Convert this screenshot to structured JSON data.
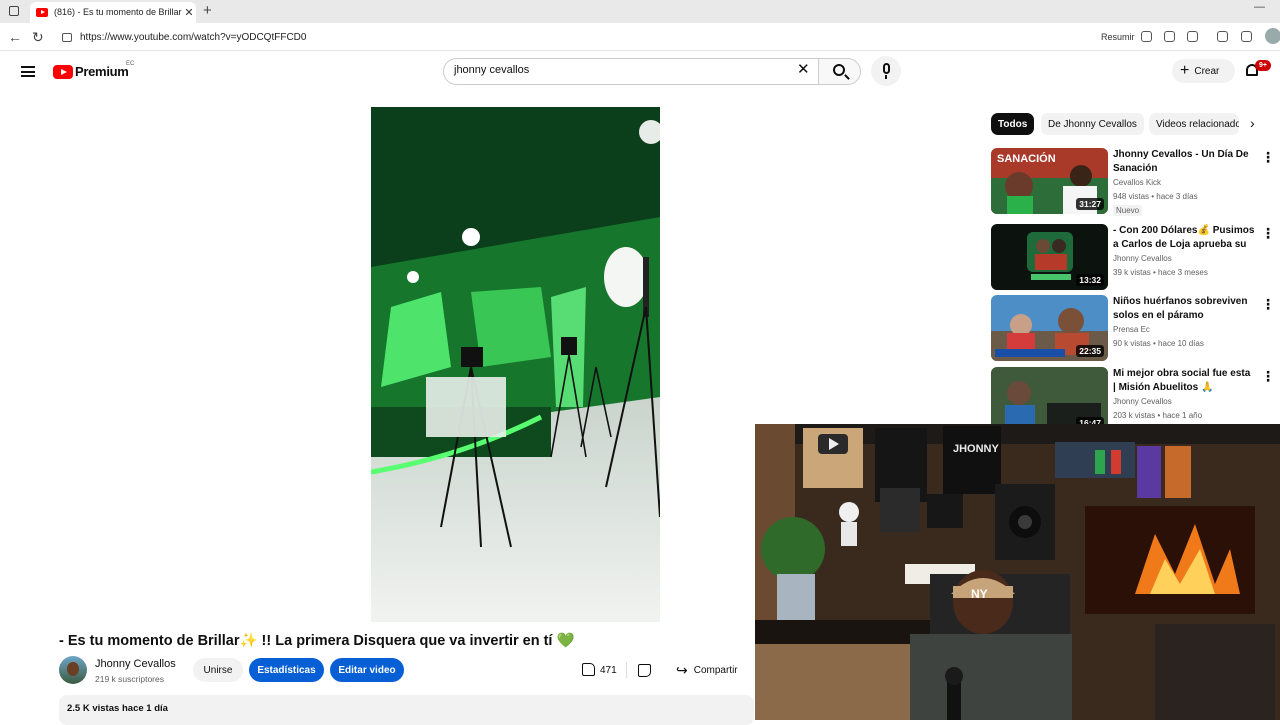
{
  "browser": {
    "tab_title": "(816) - Es tu momento de Brillar✨",
    "tab_close": "✕",
    "new_tab": "+",
    "url": "https://www.youtube.com/watch?v=yODCQtFFCD0",
    "resumir": "Resumir",
    "minimize": "—"
  },
  "header": {
    "logo": "Premium",
    "country": "EC",
    "search_value": "jhonny cevallos",
    "clear": "✕",
    "create": "Crear",
    "create_plus": "+",
    "notifications": "9+"
  },
  "video": {
    "title": "- Es tu momento de Brillar✨ !! La primera Disquera que va invertir en tí 💚",
    "channel": "Jhonny Cevallos",
    "subscribers": "219 k suscriptores",
    "join": "Unirse",
    "stats": "Estadísticas",
    "edit": "Editar video",
    "likes": "471",
    "share": "Compartir",
    "views": "2.5 K vistas",
    "date": "hace 1 día"
  },
  "sidebar": {
    "chips": [
      "Todos",
      "De Jhonny Cevallos",
      "Videos relacionados"
    ],
    "recommendations": [
      {
        "title": "Jhonny Cevallos - Un Día De Sanación",
        "channel": "Cevallos Kick",
        "meta": "948 vistas • hace 3 días",
        "badge": "Nuevo",
        "duration": "31:27",
        "thumb_text": "SANACIÓN"
      },
      {
        "title": "- Con 200 Dólares💰 Pusimos a Carlos de Loja aprueba su ...",
        "channel": "Jhonny Cevallos",
        "meta": "39 k vistas • hace 3 meses",
        "badge": "",
        "duration": "13:32",
        "thumb_text": ""
      },
      {
        "title": "Niños huérfanos sobreviven solos en el páramo ecuatoriano.",
        "channel": "Prensa Ec",
        "meta": "90 k vistas • hace 10 días",
        "badge": "",
        "duration": "22:35",
        "thumb_text": ""
      },
      {
        "title": "Mi mejor obra social fue esta | Misión Abuelitos 🙏",
        "channel": "Jhonny Cevallos",
        "meta": "203 k vistas • hace 1 año",
        "badge": "",
        "duration": "16:47",
        "thumb_text": ""
      }
    ]
  },
  "webcam": {
    "sign_text": "JHONNY",
    "cap_logo": "NY"
  }
}
